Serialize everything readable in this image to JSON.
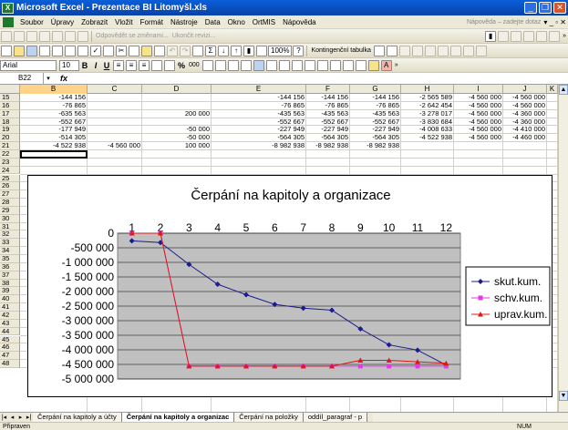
{
  "window": {
    "title": "Microsoft Excel - Prezentace BI Litomyšl.xls",
    "icon": "excel-icon"
  },
  "menu": {
    "items": [
      "Soubor",
      "Úpravy",
      "Zobrazit",
      "Vložit",
      "Formát",
      "Nástroje",
      "Data",
      "Okno",
      "OrtMIS",
      "Nápověda"
    ],
    "help_placeholder": "Nápověda – zadejte dotaz"
  },
  "toolbar": {
    "reply_text": "Odpovědět se změnami...",
    "end_review": "Ukončit revizi...",
    "zoom": "100%",
    "pivot": "Kontingenční tabulka",
    "font": "Arial",
    "size": "10",
    "bold": "B",
    "italic": "I",
    "underline": "U",
    "percent": "%",
    "thousands": "000"
  },
  "formula_bar": {
    "cell_ref": "B22",
    "fx": "fx",
    "value": ""
  },
  "columns": [
    "B",
    "C",
    "D",
    "E",
    "F",
    "G",
    "H",
    "I",
    "J",
    "K"
  ],
  "selected_column": "B",
  "rows": [
    {
      "n": "15",
      "cells": [
        "-144 156",
        "",
        "",
        "-144 156",
        "-144 156",
        "-144 156",
        "-2 565 589",
        "-4 560 000",
        "-4 560 000"
      ]
    },
    {
      "n": "16",
      "cells": [
        "-76 865",
        "",
        "",
        "-76 865",
        "-76 865",
        "-76 865",
        "-2 642 454",
        "-4 560 000",
        "-4 560 000"
      ]
    },
    {
      "n": "17",
      "cells": [
        "-635 563",
        "",
        "200 000",
        "-435 563",
        "-435 563",
        "-435 563",
        "-3 278 017",
        "-4 560 000",
        "-4 360 000"
      ]
    },
    {
      "n": "18",
      "cells": [
        "-552 667",
        "",
        "",
        "-552 667",
        "-552 667",
        "-552 667",
        "-3 830 684",
        "-4 560 000",
        "-4 360 000"
      ]
    },
    {
      "n": "19",
      "cells": [
        "-177 949",
        "",
        "-50 000",
        "-227 949",
        "-227 949",
        "-227 949",
        "-4 008 633",
        "-4 560 000",
        "-4 410 000"
      ]
    },
    {
      "n": "20",
      "cells": [
        "-514 305",
        "",
        "-50 000",
        "-564 305",
        "-564 305",
        "-564 305",
        "-4 522 938",
        "-4 560 000",
        "-4 460 000"
      ]
    },
    {
      "n": "21",
      "cells": [
        "-4 522 938",
        "-4 560 000",
        "100 000",
        "-8 982 938",
        "-8 982 938",
        "-8 982 938",
        "",
        "",
        ""
      ]
    }
  ],
  "empty_rows": [
    "22",
    "23",
    "24",
    "25",
    "26",
    "27",
    "28",
    "29",
    "30",
    "31",
    "32",
    "33",
    "34",
    "35",
    "36",
    "37",
    "38",
    "39",
    "40",
    "41",
    "42",
    "43",
    "44",
    "45",
    "46",
    "47",
    "48"
  ],
  "chart_data": {
    "type": "line",
    "title": "Čerpání na kapitoly a organizace",
    "x": [
      1,
      2,
      3,
      4,
      5,
      6,
      7,
      8,
      9,
      10,
      11,
      12
    ],
    "x_tick_labels": [
      "1",
      "2",
      "3",
      "4",
      "5",
      "6",
      "7",
      "8",
      "9",
      "10",
      "11",
      "12"
    ],
    "y_ticks": [
      -5000000,
      -4500000,
      -4000000,
      -3500000,
      -3000000,
      -2500000,
      -2000000,
      -1500000,
      -1000000,
      -500000,
      0
    ],
    "y_tick_labels": [
      "-5 000 000",
      "-4 500 000",
      "-4 000 000",
      "-3 500 000",
      "-3 000 000",
      "-2 500 000",
      "-2 000 000",
      "-1 500 000",
      "-1 000 000",
      "-500 000",
      "0"
    ],
    "ylim": [
      -5000000,
      0
    ],
    "y_reversed": true,
    "grid": true,
    "legend": "right",
    "series": [
      {
        "name": "skut.kum.",
        "color": "#1c1c8c",
        "marker": "diamond",
        "values": [
          -260000,
          -320000,
          -1070000,
          -1750000,
          -2110000,
          -2440000,
          -2570000,
          -2640000,
          -3280000,
          -3830000,
          -4010000,
          -4520000
        ]
      },
      {
        "name": "schv.kum.",
        "color": "#e23ae6",
        "marker": "square",
        "values": [
          0,
          0,
          -4560000,
          -4560000,
          -4560000,
          -4560000,
          -4560000,
          -4560000,
          -4560000,
          -4560000,
          -4560000,
          -4560000
        ]
      },
      {
        "name": "uprav.kum.",
        "color": "#e01818",
        "marker": "triangle",
        "values": [
          0,
          0,
          -4560000,
          -4560000,
          -4560000,
          -4560000,
          -4560000,
          -4560000,
          -4360000,
          -4360000,
          -4410000,
          -4460000
        ]
      }
    ]
  },
  "sheet_tabs": [
    "Čerpání na kapitoly a účty",
    "Čerpání na kapitoly a organizac",
    "Čerpání na položky",
    "oddíl_paragraf - p"
  ],
  "active_tab": 1,
  "status": {
    "left": "Připraven",
    "right": "NUM"
  }
}
